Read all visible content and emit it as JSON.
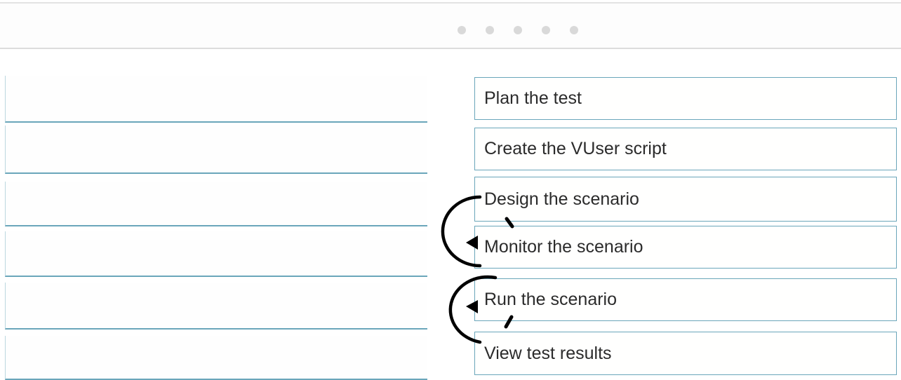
{
  "pager": {
    "dot_count": 5
  },
  "targets": {
    "slot_count": 6
  },
  "options": [
    {
      "label": "Plan the test"
    },
    {
      "label": "Create the VUser script"
    },
    {
      "label": "Design the scenario"
    },
    {
      "label": "Monitor the scenario"
    },
    {
      "label": "Run the scenario"
    },
    {
      "label": "View test results"
    }
  ]
}
